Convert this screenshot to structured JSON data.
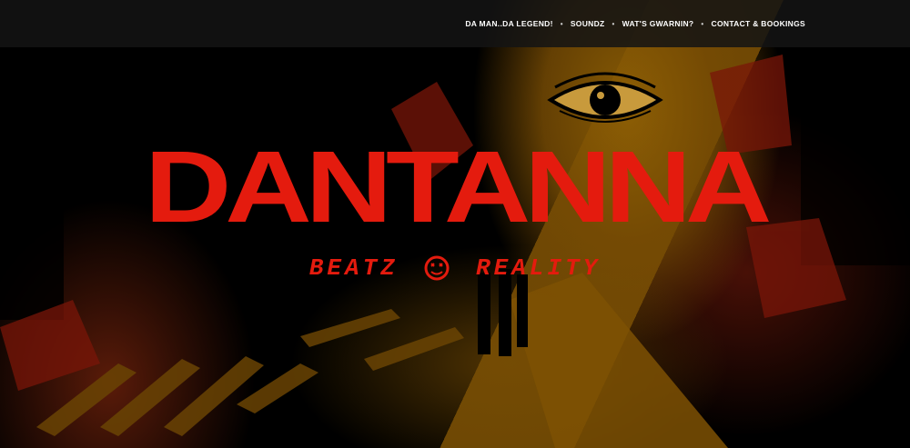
{
  "nav": {
    "items": [
      {
        "label": "DA MAN..DA LEGEND!"
      },
      {
        "label": "SOUNDZ"
      },
      {
        "label": "WAT'S GWARNIN?"
      },
      {
        "label": "CONTACT & BOOKINGS"
      }
    ],
    "separator": "•"
  },
  "hero": {
    "logo_text": "DANTANNA",
    "tagline_left": "BEATZ",
    "tagline_right": "REALITY",
    "background_icon": "eye-icon"
  },
  "colors": {
    "brand_red": "#e41b0e",
    "ochre": "#8e5f05",
    "nav_bg": "#141414"
  }
}
